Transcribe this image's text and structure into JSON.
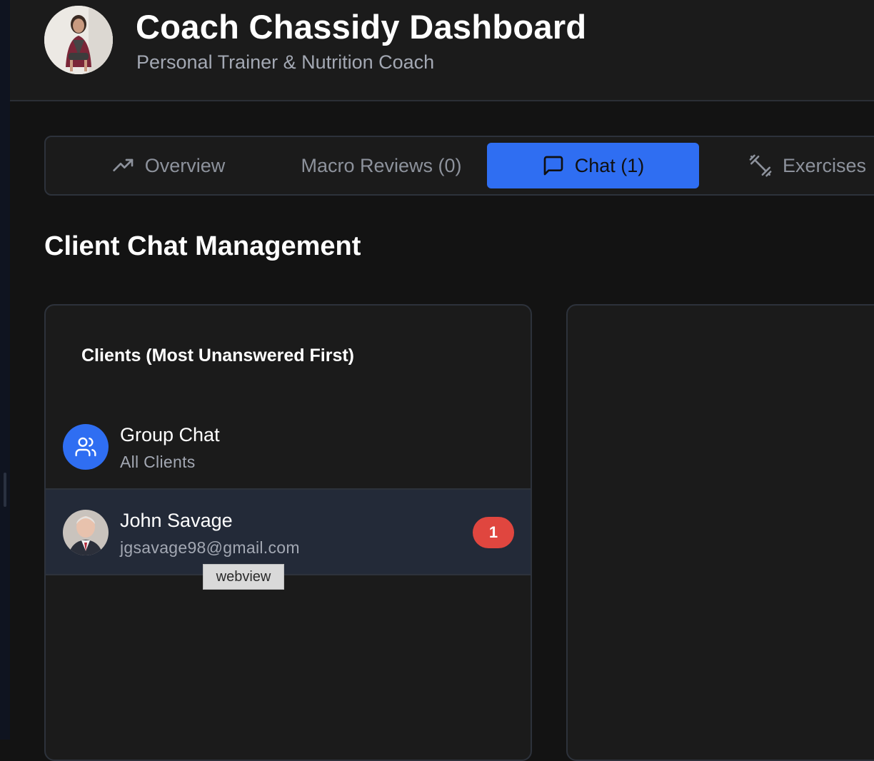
{
  "header": {
    "title": "Coach Chassidy Dashboard",
    "subtitle": "Personal Trainer & Nutrition Coach"
  },
  "tabs": [
    {
      "label": "Overview",
      "icon": "trending-up-icon",
      "active": false
    },
    {
      "label": "Macro Reviews (0)",
      "icon": "",
      "active": false
    },
    {
      "label": "Chat (1)",
      "icon": "message-square-icon",
      "active": true
    },
    {
      "label": "Exercises",
      "icon": "dumbbell-icon",
      "active": false
    }
  ],
  "section_title": "Client Chat Management",
  "clients_panel": {
    "heading": "Clients (Most Unanswered First)",
    "items": [
      {
        "name": "Group Chat",
        "subtitle": "All Clients",
        "icon": "users-icon",
        "badge": ""
      },
      {
        "name": "John Savage",
        "subtitle": "jgsavage98@gmail.com",
        "icon": "avatar",
        "badge": "1",
        "selected": true
      }
    ]
  },
  "tooltip": "webview",
  "colors": {
    "accent": "#2f6ef2",
    "badge": "#e0463f",
    "background": "#131313",
    "panel": "#1b1b1b",
    "selected_row": "#232a38"
  }
}
